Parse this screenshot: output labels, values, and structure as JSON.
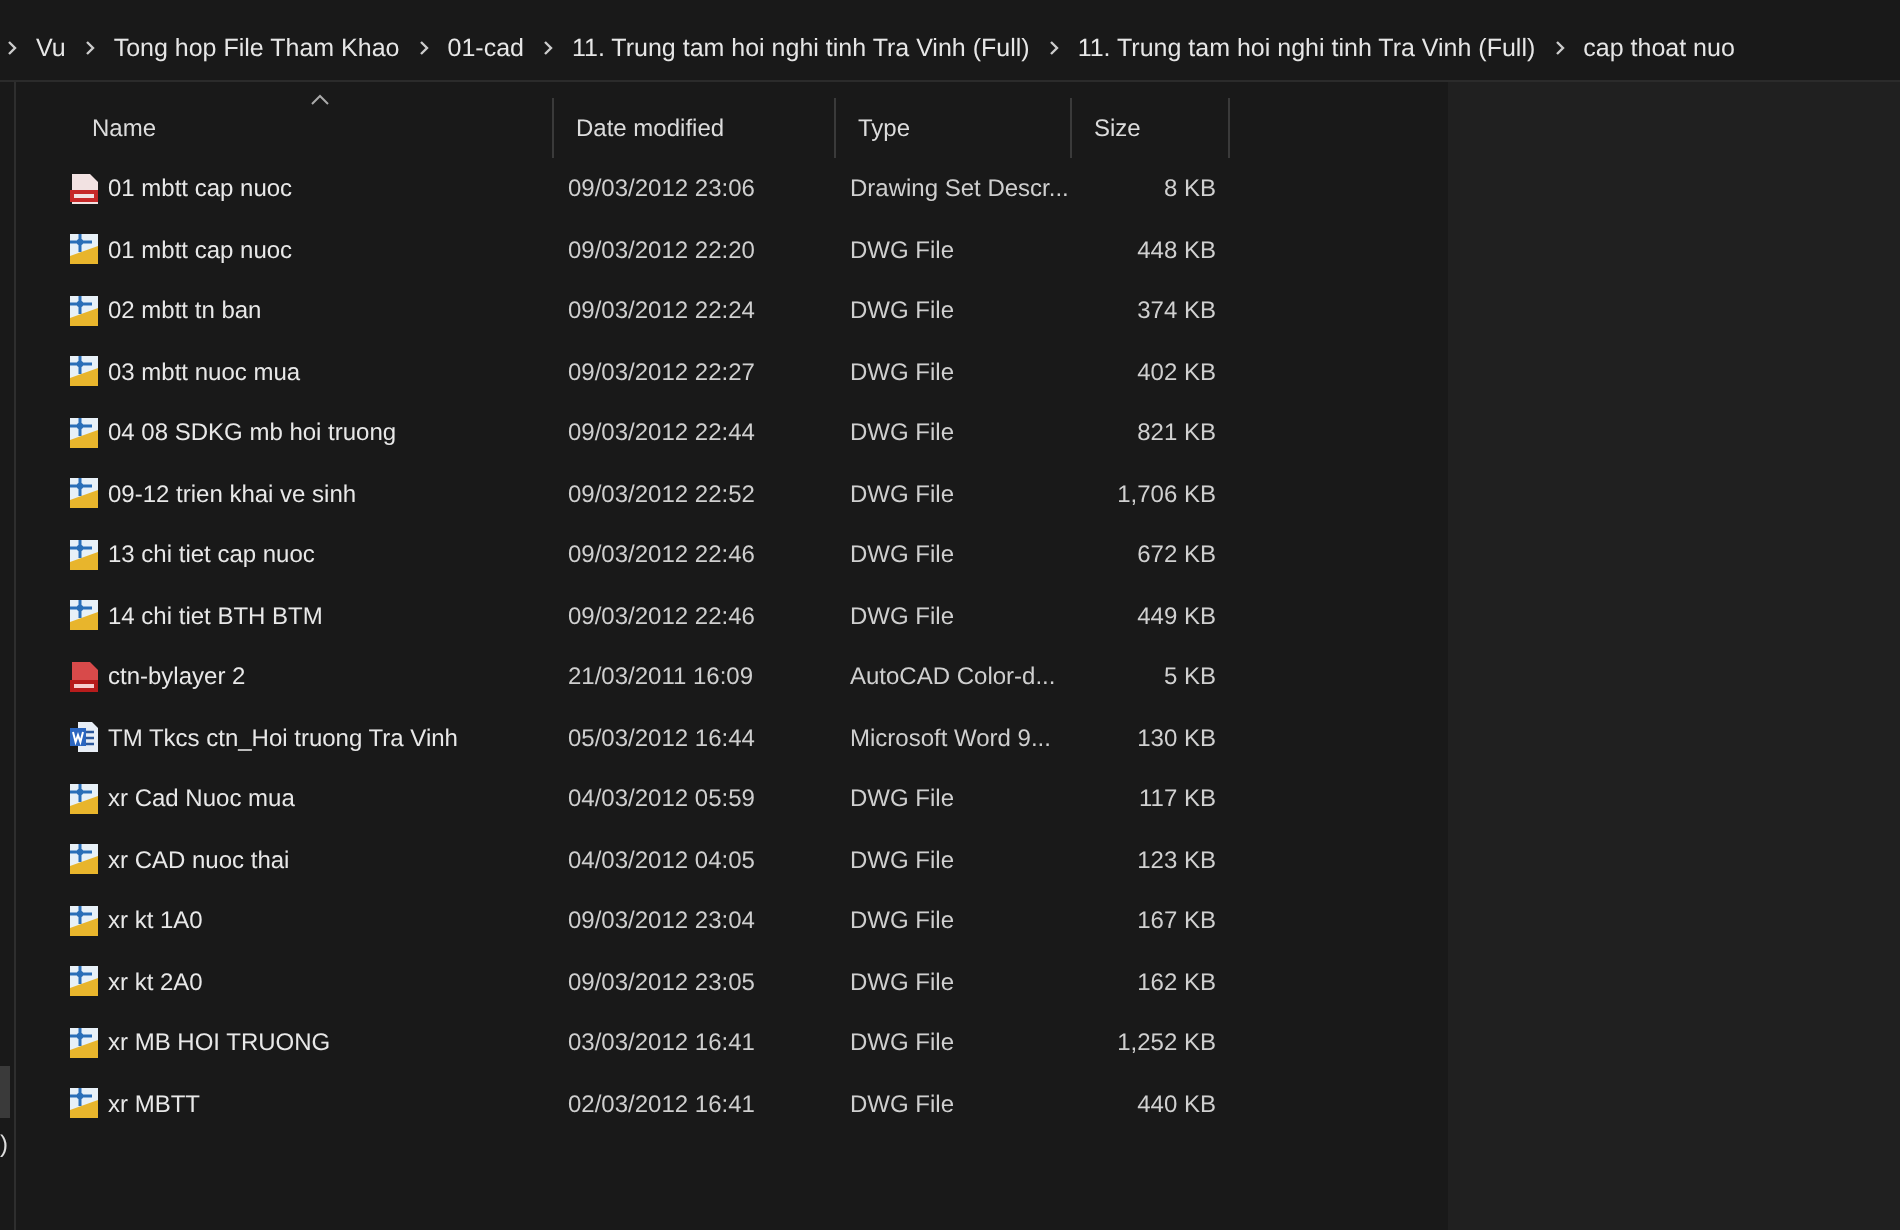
{
  "breadcrumb": [
    "Vu",
    "Tong hop File Tham Khao",
    "01-cad",
    "11. Trung tam hoi nghi tinh Tra Vinh (Full)",
    "11. Trung tam hoi nghi tinh Tra Vinh (Full)",
    "cap thoat nuo"
  ],
  "columns": [
    "Name",
    "Date modified",
    "Type",
    "Size"
  ],
  "files": [
    {
      "kind": "dsd",
      "name": "01 mbtt cap nuoc",
      "date": "09/03/2012 23:06",
      "type": "Drawing Set Descr...",
      "size": "8 KB"
    },
    {
      "kind": "dwg",
      "name": "01 mbtt cap nuoc",
      "date": "09/03/2012 22:20",
      "type": "DWG File",
      "size": "448 KB"
    },
    {
      "kind": "dwg",
      "name": "02 mbtt tn ban",
      "date": "09/03/2012 22:24",
      "type": "DWG File",
      "size": "374 KB"
    },
    {
      "kind": "dwg",
      "name": "03 mbtt nuoc mua",
      "date": "09/03/2012 22:27",
      "type": "DWG File",
      "size": "402 KB"
    },
    {
      "kind": "dwg",
      "name": "04 08 SDKG mb hoi truong",
      "date": "09/03/2012 22:44",
      "type": "DWG File",
      "size": "821 KB"
    },
    {
      "kind": "dwg",
      "name": "09-12 trien khai ve sinh",
      "date": "09/03/2012 22:52",
      "type": "DWG File",
      "size": "1,706 KB"
    },
    {
      "kind": "dwg",
      "name": "13 chi tiet cap nuoc",
      "date": "09/03/2012 22:46",
      "type": "DWG File",
      "size": "672 KB"
    },
    {
      "kind": "dwg",
      "name": "14 chi tiet BTH BTM",
      "date": "09/03/2012 22:46",
      "type": "DWG File",
      "size": "449 KB"
    },
    {
      "kind": "ctb",
      "name": "ctn-bylayer 2",
      "date": "21/03/2011 16:09",
      "type": "AutoCAD Color-d...",
      "size": "5 KB"
    },
    {
      "kind": "doc",
      "name": "TM Tkcs ctn_Hoi truong Tra Vinh",
      "date": "05/03/2012 16:44",
      "type": "Microsoft Word 9...",
      "size": "130 KB"
    },
    {
      "kind": "dwg",
      "name": "xr Cad Nuoc mua",
      "date": "04/03/2012 05:59",
      "type": "DWG File",
      "size": "117 KB"
    },
    {
      "kind": "dwg",
      "name": "xr CAD nuoc thai",
      "date": "04/03/2012 04:05",
      "type": "DWG File",
      "size": "123 KB"
    },
    {
      "kind": "dwg",
      "name": "xr kt 1A0",
      "date": "09/03/2012 23:04",
      "type": "DWG File",
      "size": "167 KB"
    },
    {
      "kind": "dwg",
      "name": "xr kt 2A0",
      "date": "09/03/2012 23:05",
      "type": "DWG File",
      "size": "162 KB"
    },
    {
      "kind": "dwg",
      "name": "xr MB HOI TRUONG",
      "date": "03/03/2012 16:41",
      "type": "DWG File",
      "size": "1,252 KB"
    },
    {
      "kind": "dwg",
      "name": "xr MBTT",
      "date": "02/03/2012 16:41",
      "type": "DWG File",
      "size": "440 KB"
    }
  ],
  "nav_fragment": ")"
}
